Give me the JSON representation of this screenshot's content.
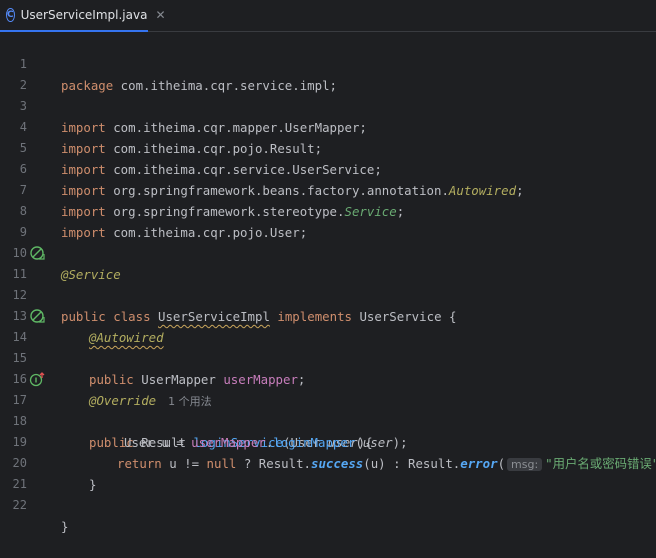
{
  "tab": {
    "title": "UserServiceImpl.java",
    "close": "✕",
    "icon_letter": "C"
  },
  "lines": {
    "n1": "1",
    "n2": "2",
    "n3": "3",
    "n4": "4",
    "n5": "5",
    "n6": "6",
    "n7": "7",
    "n8": "8",
    "n9": "9",
    "n10": "10",
    "n11": "11",
    "n12": "12",
    "n13": "13",
    "n14": "14",
    "n15": "15",
    "n16": "16",
    "n17": "17",
    "n18": "18",
    "n19": "19",
    "n20": "20",
    "n21": "21",
    "n22": "22"
  },
  "code": {
    "kw_package": "package",
    "pkg": " com.itheima.cqr.service.impl;",
    "kw_import": "import",
    "imp3": " com.itheima.cqr.mapper.UserMapper;",
    "imp4": " com.itheima.cqr.pojo.Result;",
    "imp5": " com.itheima.cqr.service.UserService;",
    "imp6a": " org.springframework.beans.factory.annotation.",
    "imp6b": "Autowired",
    "imp7a": " org.springframework.stereotype.",
    "imp7b": "Service",
    "imp8": " com.itheima.cqr.pojo.User;",
    "ann_service": "@Service",
    "kw_public": "public",
    "kw_class": "class",
    "class_name": "UserServiceImpl",
    "kw_implements": "implements",
    "iface": "UserService",
    "open_brace": "{",
    "ann_autowired": "@Autowired",
    "type_mapper": "UserMapper",
    "field_mapper": "userMapper",
    "semi": ";",
    "ann_override": "@Override",
    "usage_hint": "1 个用法",
    "type_result": "Result",
    "method_login": "loginService",
    "type_user": "User",
    "param_user": "user",
    "var_u": "u",
    "method_loginMapper": "loginMapper",
    "kw_return": "return",
    "kw_null": "null",
    "static_success": "success",
    "static_error": "error",
    "hint_msg": "msg:",
    "str_msg": "\"用户名或密码错误\"",
    "close_brace": "}"
  }
}
